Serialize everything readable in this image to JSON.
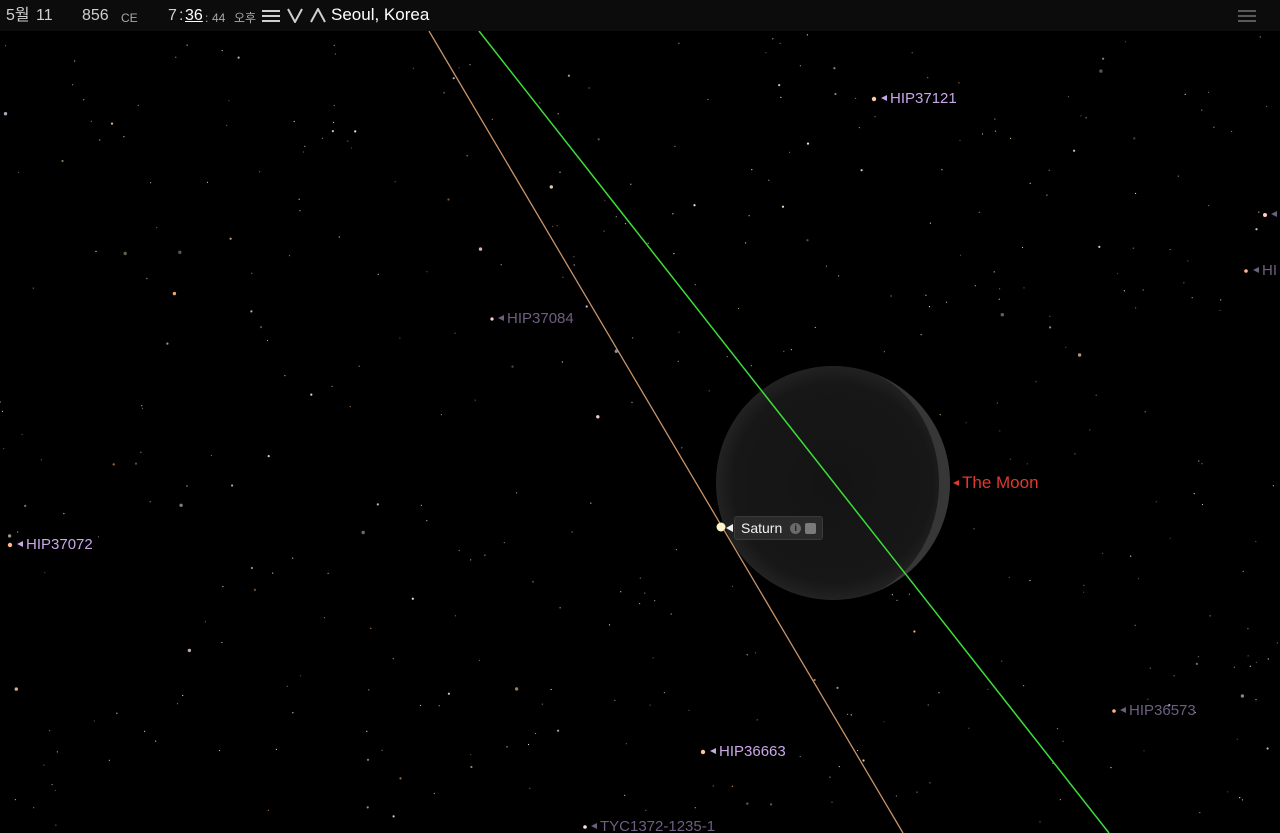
{
  "topbar": {
    "month": "5월",
    "day": "11",
    "year": "856",
    "era": "CE",
    "hour": "7",
    "minute": "36",
    "second": "44",
    "ampm": "오후",
    "location": "Seoul, Korea"
  },
  "objects": {
    "moon": {
      "label": "The Moon",
      "color": "#e0392f"
    },
    "saturn": {
      "label": "Saturn"
    },
    "stars": {
      "hip37121": "HIP37121",
      "hip37084": "HIP37084",
      "hip37072": "HIP37072",
      "hip36663": "HIP36663",
      "hip36573": "HIP36573",
      "tyc1372": "TYC1372-1235-1",
      "hip_edge": "HI"
    }
  },
  "colors": {
    "ecliptic": "#c8946a",
    "equator": "#3ddc3a",
    "label_bright": "#c9a6e8",
    "label_dim": "#6e5f80"
  }
}
